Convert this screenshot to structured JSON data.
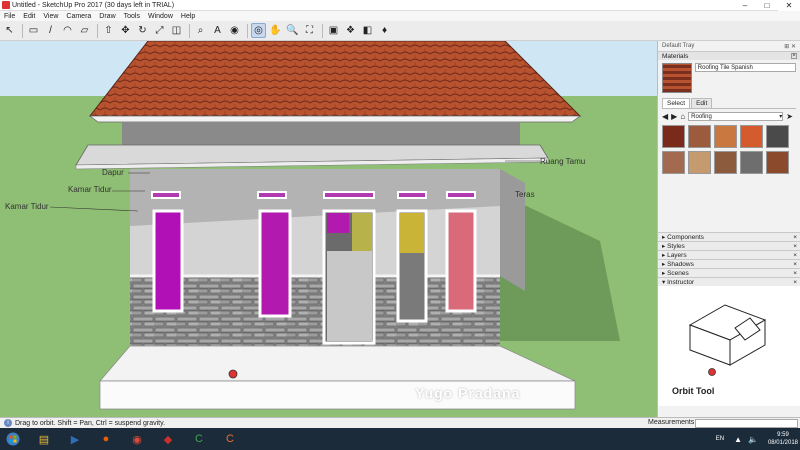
{
  "window": {
    "title": "Untitled - SketchUp Pro 2017 (30 days left in TRIAL)"
  },
  "menu": [
    "File",
    "Edit",
    "View",
    "Camera",
    "Draw",
    "Tools",
    "Window",
    "Help"
  ],
  "toolbar": [
    {
      "icon": "select-arrow-icon",
      "glyph": "↖"
    },
    {
      "icon": "eraser-icon",
      "glyph": "▭"
    },
    {
      "icon": "line-icon",
      "glyph": "/"
    },
    {
      "icon": "arc-icon",
      "glyph": "◠"
    },
    {
      "icon": "rectangle-icon",
      "glyph": "▱"
    },
    {
      "icon": "push-pull-icon",
      "glyph": "⇧"
    },
    {
      "icon": "move-icon",
      "glyph": "✥"
    },
    {
      "icon": "rotate-icon",
      "glyph": "↻"
    },
    {
      "icon": "scale-icon",
      "glyph": "⤢"
    },
    {
      "icon": "offset-icon",
      "glyph": "◫"
    },
    {
      "icon": "tape-measure-icon",
      "glyph": "⌕"
    },
    {
      "icon": "text-icon",
      "glyph": "A"
    },
    {
      "icon": "paint-bucket-icon",
      "glyph": "◉"
    },
    {
      "icon": "orbit-icon",
      "glyph": "◎",
      "active": true
    },
    {
      "icon": "pan-icon",
      "glyph": "✋"
    },
    {
      "icon": "zoom-icon",
      "glyph": "🔍"
    },
    {
      "icon": "zoom-extents-icon",
      "glyph": "⛶"
    },
    {
      "icon": "warehouse-icon",
      "glyph": "▣"
    },
    {
      "icon": "extension-warehouse-icon",
      "glyph": "❖"
    },
    {
      "icon": "layout-icon",
      "glyph": "◧"
    },
    {
      "icon": "ruby-console-icon",
      "glyph": "♦"
    }
  ],
  "viewport": {
    "labels": [
      "Dapur",
      "Kamar Tidur",
      "Kamar Tidur",
      "Ruang Tamu",
      "Teras"
    ],
    "watermark": "Yugo Pradana"
  },
  "tray": {
    "title": "Default Tray",
    "materials": {
      "header": "Materials",
      "name": "Roofing Tile Spanish",
      "tabs": [
        "Select",
        "Edit"
      ],
      "library": "Roofing",
      "swatches": [
        "#7a2a1a",
        "#9b5b3c",
        "#c9783f",
        "#d55a2e",
        "#4a4a4a",
        "#a26b4f",
        "#c69a6f",
        "#8c5a3c",
        "#6e6e6e",
        "#8a4a2b"
      ]
    },
    "panels": [
      "Components",
      "Styles",
      "Layers",
      "Shadows",
      "Scenes",
      "Instructor"
    ],
    "instructor": {
      "title": "Orbit Tool"
    }
  },
  "status": {
    "hint": "Drag to orbit. Shift = Pan, Ctrl = suspend gravity.",
    "measurements_label": "Measurements"
  },
  "taskbar": {
    "apps": [
      {
        "icon": "file-explorer-icon",
        "glyph": "▤",
        "color": "#e8b73a"
      },
      {
        "icon": "media-player-icon",
        "glyph": "▶",
        "color": "#2f6db5"
      },
      {
        "icon": "firefox-icon",
        "glyph": "●",
        "color": "#e66000"
      },
      {
        "icon": "chrome-icon",
        "glyph": "◉",
        "color": "#dd4b39"
      },
      {
        "icon": "sketchup-icon",
        "glyph": "◆",
        "color": "#c9302c"
      },
      {
        "icon": "camtasia-green-icon",
        "glyph": "C",
        "color": "#3aa84a"
      },
      {
        "icon": "camtasia-orange-icon",
        "glyph": "C",
        "color": "#e8712b"
      }
    ],
    "lang": "EN",
    "time": "9:59",
    "date": "08/01/2018"
  }
}
